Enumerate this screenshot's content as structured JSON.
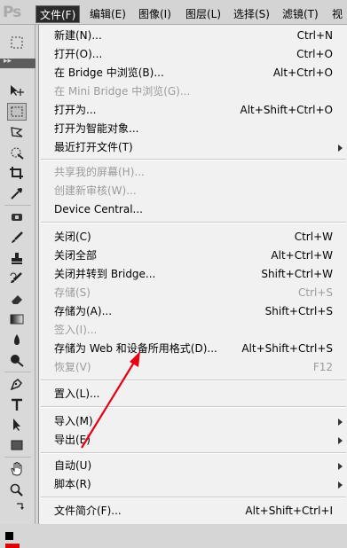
{
  "app": {
    "logo": "Ps"
  },
  "menubar": {
    "items": [
      {
        "label": "文件(F)",
        "active": true
      },
      {
        "label": "编辑(E)"
      },
      {
        "label": "图像(I)"
      },
      {
        "label": "图层(L)"
      },
      {
        "label": "选择(S)"
      },
      {
        "label": "滤镜(T)"
      },
      {
        "label": "视"
      }
    ]
  },
  "toolbar": {
    "collapse_label": "▸▸",
    "tools": [
      "move-tool-icon",
      "marquee-tool-icon",
      "lasso-tool-icon",
      "quick-select-tool-icon",
      "crop-tool-icon",
      "eyedropper-tool-icon",
      "spot-healing-tool-icon",
      "brush-tool-icon",
      "clone-stamp-tool-icon",
      "history-brush-tool-icon",
      "eraser-tool-icon",
      "gradient-tool-icon",
      "blur-tool-icon",
      "dodge-tool-icon",
      "pen-tool-icon",
      "type-tool-icon",
      "path-selection-tool-icon",
      "rectangle-tool-icon",
      "hand-tool-icon",
      "zoom-tool-icon"
    ],
    "colors": {
      "foreground": "#000000",
      "accent": "#e00000"
    }
  },
  "file_menu": {
    "new": {
      "label": "新建(N)...",
      "shortcut": "Ctrl+N"
    },
    "open": {
      "label": "打开(O)...",
      "shortcut": "Ctrl+O"
    },
    "browse_bridge": {
      "label": "在 Bridge 中浏览(B)...",
      "shortcut": "Alt+Ctrl+O"
    },
    "browse_mini_bridge": {
      "label": "在 Mini Bridge 中浏览(G)...",
      "shortcut": ""
    },
    "open_as": {
      "label": "打开为...",
      "shortcut": "Alt+Shift+Ctrl+O"
    },
    "open_as_smart": {
      "label": "打开为智能对象...",
      "shortcut": ""
    },
    "recent": {
      "label": "最近打开文件(T)"
    },
    "share_screen": {
      "label": "共享我的屏幕(H)..."
    },
    "new_review": {
      "label": "创建新审核(W)..."
    },
    "device_central": {
      "label": "Device Central..."
    },
    "close": {
      "label": "关闭(C)",
      "shortcut": "Ctrl+W"
    },
    "close_all": {
      "label": "关闭全部",
      "shortcut": "Alt+Ctrl+W"
    },
    "close_goto_bridge": {
      "label": "关闭并转到 Bridge...",
      "shortcut": "Shift+Ctrl+W"
    },
    "save": {
      "label": "存储(S)",
      "shortcut": "Ctrl+S"
    },
    "save_as": {
      "label": "存储为(A)...",
      "shortcut": "Shift+Ctrl+S"
    },
    "check_in": {
      "label": "签入(I)..."
    },
    "save_for_web": {
      "label": "存储为 Web 和设备所用格式(D)...",
      "shortcut": "Alt+Shift+Ctrl+S"
    },
    "revert": {
      "label": "恢复(V)",
      "shortcut": "F12"
    },
    "place": {
      "label": "置入(L)..."
    },
    "import": {
      "label": "导入(M)"
    },
    "export": {
      "label": "导出(E)"
    },
    "automate": {
      "label": "自动(U)"
    },
    "scripts": {
      "label": "脚本(R)"
    },
    "file_info": {
      "label": "文件简介(F)...",
      "shortcut": "Alt+Shift+Ctrl+I"
    }
  },
  "annotation": {
    "arrow_color": "#e60012"
  }
}
